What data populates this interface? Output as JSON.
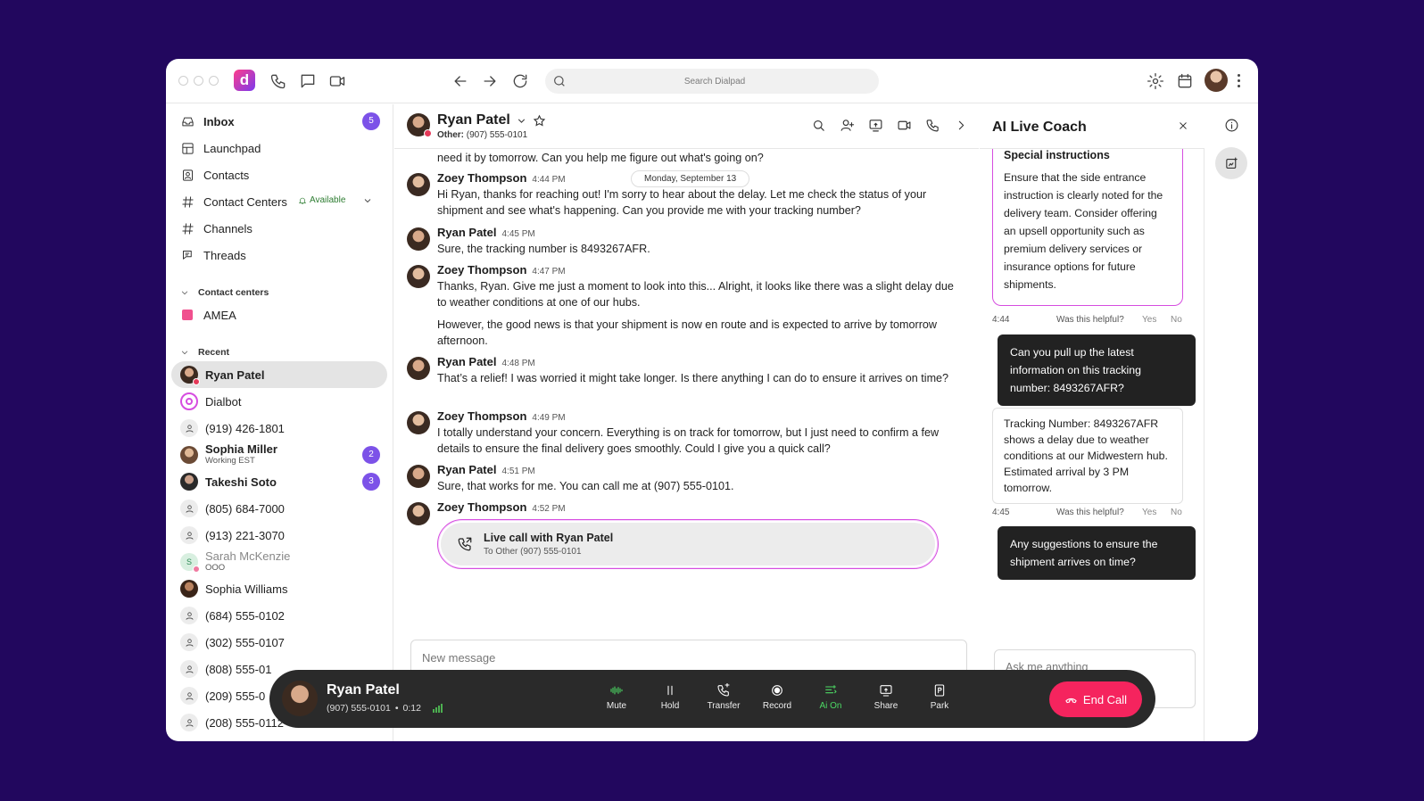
{
  "colors": {
    "background": "#22075e",
    "accent_purple": "#7c52e8",
    "ai_border": "#d64de0",
    "end_call": "#f5245e",
    "available_green": "#2e7d32",
    "ai_on_green": "#4cd964"
  },
  "topbar": {
    "search_placeholder": "Search Dialpad",
    "icons": [
      "phone-icon",
      "chat-icon",
      "video-icon",
      "back-icon",
      "forward-icon",
      "refresh-icon",
      "search-icon",
      "gear-icon",
      "calendar-icon",
      "kebab-icon"
    ]
  },
  "sidebar": {
    "nav": [
      {
        "label": "Inbox",
        "badge": "5",
        "icon": "inbox-icon"
      },
      {
        "label": "Launchpad",
        "icon": "launchpad-icon"
      },
      {
        "label": "Contacts",
        "icon": "contacts-icon"
      },
      {
        "label": "Contact Centers",
        "icon": "hash-icon",
        "status": "Available"
      },
      {
        "label": "Channels",
        "icon": "hash-icon"
      },
      {
        "label": "Threads",
        "icon": "threads-icon"
      }
    ],
    "contact_centers_heading": "Contact centers",
    "contact_centers": [
      {
        "label": "AMEA"
      }
    ],
    "recent_heading": "Recent",
    "recent": [
      {
        "label": "Ryan Patel"
      },
      {
        "label": "Dialbot"
      },
      {
        "label": "(919) 426-1801"
      },
      {
        "label": "Sophia Miller",
        "sub": "Working EST",
        "badge": "2"
      },
      {
        "label": "Takeshi Soto",
        "badge": "3"
      },
      {
        "label": "(805) 684-7000"
      },
      {
        "label": "(913) 221-3070"
      },
      {
        "label": "Sarah McKenzie",
        "sub": "OOO",
        "initial": "S"
      },
      {
        "label": "Sophia Williams"
      },
      {
        "label": "(684) 555-0102"
      },
      {
        "label": "(302) 555-0107"
      },
      {
        "label": "(808) 555-01"
      },
      {
        "label": "(209) 555-0"
      },
      {
        "label": "(208) 555-0112"
      }
    ]
  },
  "chat": {
    "contact_name": "Ryan Patel",
    "contact_sub_label": "Other:",
    "contact_sub_value": "(907) 555-0101",
    "date_pill": "Monday, September 13",
    "messages": [
      {
        "text": "need it by tomorrow. Can you help me figure out what's going on?"
      },
      {
        "name": "Zoey Thompson",
        "time": "4:44 PM",
        "text": "Hi Ryan, thanks for reaching out! I'm sorry to hear about the delay. Let me check the status of your shipment and see what's happening. Can you provide me with your tracking number?"
      },
      {
        "name": "Ryan Patel",
        "time": "4:45 PM",
        "text": "Sure, the tracking number is 8493267AFR."
      },
      {
        "name": "Zoey Thompson",
        "time": "4:47 PM",
        "text": "Thanks,  Ryan. Give me just a moment to look into this... Alright, it looks like there was a slight delay due to weather conditions at one of our hubs.",
        "text2": "However, the good news is that your shipment is now en route and is expected to arrive by tomorrow afternoon."
      },
      {
        "name": "Ryan Patel",
        "time": "4:48 PM",
        "text": "That’s a relief! I was worried it might take longer. Is there anything I can do to ensure it arrives on time?"
      },
      {
        "name": "Zoey Thompson",
        "time": "4:49 PM",
        "text": "I totally understand your concern. Everything is on track for tomorrow, but I just need to confirm a few details to ensure the final delivery goes smoothly. Could I give you a quick call?"
      },
      {
        "name": "Ryan Patel",
        "time": "4:51 PM",
        "text": "Sure, that works for me. You can call me at (907) 555-0101."
      },
      {
        "name": "Zoey Thompson",
        "time": "4:52 PM"
      }
    ],
    "live_call": {
      "title": "Live call with Ryan Patel",
      "sub": "To Other (907) 555-0101"
    },
    "composer_placeholder": "New message"
  },
  "coach": {
    "title": "AI Live Coach",
    "special_title": "Special instructions",
    "special_text": "Ensure that the side entrance instruction is clearly noted for the delivery team. Consider offering an upsell opportunity such as premium delivery services or insurance options for future shipments.",
    "feedback_question": "Was this helpful?",
    "yes": "Yes",
    "no": "No",
    "time1": "4:44",
    "question1": "Can you pull up the latest information on this tracking number: 8493267AFR?",
    "response1": "Tracking Number: 8493267AFR shows a delay due to weather conditions at our Midwestern hub. Estimated arrival by 3 PM tomorrow.",
    "time2": "4:45",
    "question2": "Any suggestions to ensure the shipment arrives on time?",
    "ask_placeholder": "Ask me anything"
  },
  "callbar": {
    "name": "Ryan Patel",
    "number": "(907) 555-0101",
    "separator": "•",
    "duration": "0:12",
    "buttons": [
      {
        "label": "Mute"
      },
      {
        "label": "Hold"
      },
      {
        "label": "Transfer"
      },
      {
        "label": "Record"
      },
      {
        "label": "Ai On"
      },
      {
        "label": "Share"
      },
      {
        "label": "Park"
      }
    ],
    "end_label": "End Call"
  }
}
